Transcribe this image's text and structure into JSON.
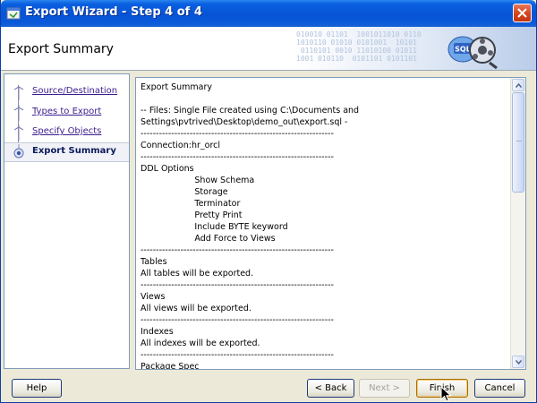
{
  "window": {
    "title": "Export Wizard - Step 4 of 4"
  },
  "header": {
    "page_title": "Export Summary",
    "binary_text": "010010 01101  1001011010 0110\n1010110 01010 0101001  10101\n 0110101 0010 11010100 01011\n1001 010110  0101101 0101101",
    "logo_text": "SQL"
  },
  "nav": {
    "items": [
      {
        "label": "Source/Destination",
        "active": false
      },
      {
        "label": "Types to Export",
        "active": false
      },
      {
        "label": "Specify Objects",
        "active": false
      },
      {
        "label": "Export Summary",
        "active": true
      }
    ]
  },
  "summary": {
    "lines": [
      "Export Summary",
      "",
      "-- Files: Single File created using C:\\Documents and",
      "Settings\\pvtrived\\Desktop\\demo_out\\export.sql -",
      "---------------------------------------------------------------",
      "Connection:hr_orcl",
      "---------------------------------------------------------------",
      "DDL Options",
      "                    Show Schema",
      "                    Storage",
      "                    Terminator",
      "                    Pretty Print",
      "                    Include BYTE keyword",
      "                    Add Force to Views",
      "---------------------------------------------------------------",
      "Tables",
      "All tables will be exported.",
      "---------------------------------------------------------------",
      "Views",
      "All views will be exported.",
      "---------------------------------------------------------------",
      "Indexes",
      "All indexes will be exported.",
      "---------------------------------------------------------------",
      "Package Spec"
    ]
  },
  "buttons": {
    "help": "Help",
    "back": "< Back",
    "next": "Next >",
    "finish": "Finish",
    "cancel": "Cancel"
  },
  "colors": {
    "titlebar": "#0753d6",
    "close": "#d2451f",
    "nav_link": "#3a1e8c",
    "nav_active": "#0c1a5a"
  }
}
